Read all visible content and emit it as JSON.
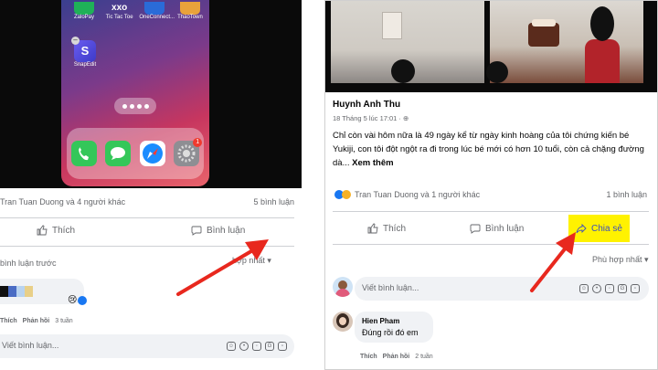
{
  "left": {
    "phone_apps": [
      {
        "label": "ZaloPay"
      },
      {
        "label": "Tic Tac Toe"
      },
      {
        "label": "OneConnect..."
      },
      {
        "label": "ThaoTown"
      }
    ],
    "snap_app": {
      "label": "SnapEdit",
      "glyph": "S"
    },
    "dock_badge": "1",
    "reactions_text": "Tran Tuan Duong và 4 người khác",
    "comment_count": "5 bình luận",
    "like_label": "Thích",
    "comment_label": "Bình luận",
    "previous_comments": "bình luận trước",
    "sort_label": "hợp nhất ▾",
    "comment_meta": {
      "like": "Thích",
      "reply": "Phản hồi",
      "time": "3 tuần"
    },
    "input_placeholder": "Viết bình luận..."
  },
  "right": {
    "post": {
      "author": "Huynh Anh Thu",
      "time": "18 Tháng 5 lúc 17:01 · ⊕",
      "body": "Chỉ còn vài hôm nữa là 49 ngày kể từ ngày kinh hoàng của tôi chứng kiến bé Yukiji, con tôi đột ngột ra đi trong lúc bé mới có hơn 10 tuổi, còn cả chặng đường dà...",
      "see_more": "Xem thêm"
    },
    "reactions_text": "Tran Tuan Duong và 1 người khác",
    "comment_count": "1 bình luận",
    "like_label": "Thích",
    "comment_label": "Bình luận",
    "share_label": "Chia sẻ",
    "sort_label": "Phù hợp nhất ▾",
    "input_placeholder": "Viết bình luận...",
    "comment": {
      "name": "Hien Pham",
      "text": "Đúng rồi đó em"
    },
    "comment_meta": {
      "like": "Thích",
      "reply": "Phản hồi",
      "time": "2 tuần"
    }
  },
  "colors": {
    "arrow": "#e8281e",
    "highlight": "#fff200",
    "link": "#3b4fc0"
  }
}
